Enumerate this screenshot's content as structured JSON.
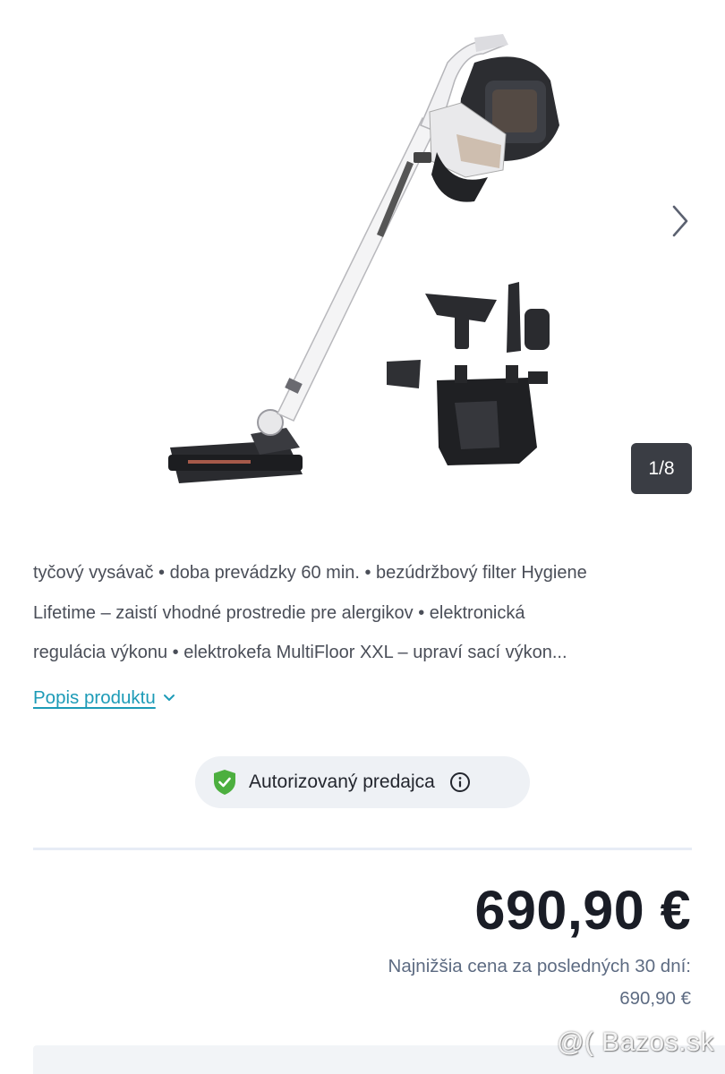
{
  "gallery": {
    "counter": "1/8",
    "image_name": "stick-vacuum-with-accessories-photo",
    "next_icon": "chevron-right-icon"
  },
  "description": {
    "lines": [
      "tyčový vysávač • doba prevádzky 60 min. • bezúdržbový filter Hygiene",
      "Lifetime – zaistí vhodné prostredie pre alergikov • elektronická",
      "regulácia výkonu • elektrokefa MultiFloor XXL – upraví sací výkon..."
    ]
  },
  "product_description_link": {
    "label": "Popis produktu",
    "icon": "chevron-down-icon"
  },
  "dealer_badge": {
    "label": "Autorizovaný predajca",
    "icon": "shield-check-icon",
    "info_icon": "info-icon",
    "accent_color": "#4caf3f"
  },
  "price": {
    "value": "690,90 €",
    "lowest_label": "Najnižšia cena za posledných 30 dní:",
    "lowest_value": "690,90 €"
  },
  "watermark": "@( Bazos.sk",
  "colors": {
    "link": "#1d9bb7",
    "price_text": "#1a1d26",
    "muted_text": "#5d6b82",
    "badge_bg": "#eef1f5"
  }
}
